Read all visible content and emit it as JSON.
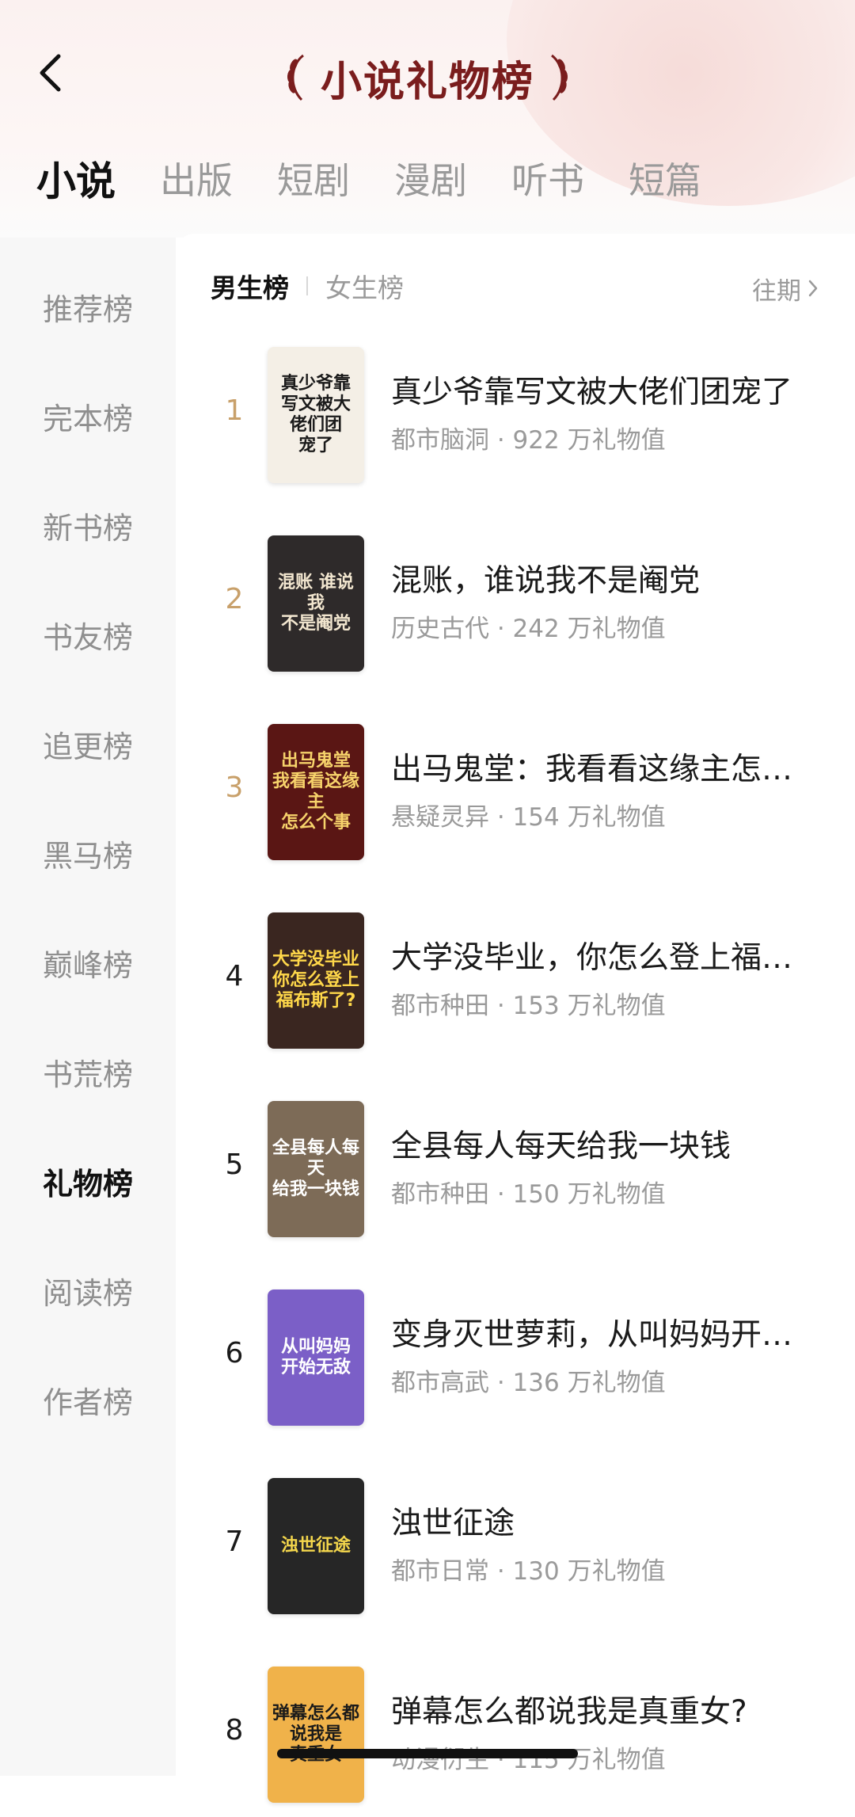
{
  "header": {
    "title": "小说礼物榜",
    "back_icon": "chevron-left-icon"
  },
  "category_tabs": [
    {
      "label": "小说",
      "active": true
    },
    {
      "label": "出版",
      "active": false
    },
    {
      "label": "短剧",
      "active": false
    },
    {
      "label": "漫剧",
      "active": false
    },
    {
      "label": "听书",
      "active": false
    },
    {
      "label": "短篇",
      "active": false
    }
  ],
  "sidebar": {
    "items": [
      {
        "label": "推荐榜",
        "active": false
      },
      {
        "label": "完本榜",
        "active": false
      },
      {
        "label": "新书榜",
        "active": false
      },
      {
        "label": "书友榜",
        "active": false
      },
      {
        "label": "追更榜",
        "active": false
      },
      {
        "label": "黑马榜",
        "active": false
      },
      {
        "label": "巅峰榜",
        "active": false
      },
      {
        "label": "书荒榜",
        "active": false
      },
      {
        "label": "礼物榜",
        "active": true
      },
      {
        "label": "阅读榜",
        "active": false
      },
      {
        "label": "作者榜",
        "active": false
      }
    ]
  },
  "gender_tabs": {
    "male": "男生榜",
    "female": "女生榜",
    "active": "male"
  },
  "past_link": {
    "label": "往期",
    "icon": "chevron-right-icon"
  },
  "books": [
    {
      "rank": "1",
      "title": "真少爷靠写文被大佬们团宠了",
      "meta": "都市脑洞 · 922 万礼物值",
      "cover_text": "真少爷靠\n写文被大\n佬们团\n宠了",
      "cover_bg": "#f4efe6",
      "cover_fg": "#1a1a1a"
    },
    {
      "rank": "2",
      "title": "混账，谁说我不是阉党",
      "meta": "历史古代 · 242 万礼物值",
      "cover_text": "混账 谁说我\n不是阉党",
      "cover_bg": "#2e2a2a",
      "cover_fg": "#f2e6cf"
    },
    {
      "rank": "3",
      "title": "出马鬼堂：我看看这缘主怎…",
      "meta": "悬疑灵异 · 154 万礼物值",
      "cover_text": "出马鬼堂\n我看看这缘主\n怎么个事",
      "cover_bg": "#5a1614",
      "cover_fg": "#f7d36b"
    },
    {
      "rank": "4",
      "title": "大学没毕业，你怎么登上福…",
      "meta": "都市种田 · 153 万礼物值",
      "cover_text": "大学没毕业\n你怎么登上\n福布斯了?",
      "cover_bg": "#3a2620",
      "cover_fg": "#ffd84a"
    },
    {
      "rank": "5",
      "title": "全县每人每天给我一块钱",
      "meta": "都市种田 · 150 万礼物值",
      "cover_text": "全县每人每天\n给我一块钱",
      "cover_bg": "#7d6b57",
      "cover_fg": "#ffffff"
    },
    {
      "rank": "6",
      "title": "变身灭世萝莉，从叫妈妈开…",
      "meta": "都市高武 · 136 万礼物值",
      "cover_text": "从叫妈妈\n开始无敌",
      "cover_bg": "#7b5fc7",
      "cover_fg": "#ffffff"
    },
    {
      "rank": "7",
      "title": "浊世征途",
      "meta": "都市日常 · 130 万礼物值",
      "cover_text": "浊世征途",
      "cover_bg": "#262626",
      "cover_fg": "#f3d64c"
    },
    {
      "rank": "8",
      "title": "弹幕怎么都说我是真重女?",
      "meta": "动漫衍生 · 115 万礼物值",
      "cover_text": "弹幕怎么都说我是\n真重女",
      "cover_bg": "#f0b24a",
      "cover_fg": "#1a1a1a"
    }
  ],
  "colors": {
    "title": "#7a1d1d",
    "top_rank": "#c8a06a",
    "muted": "#9a9a9a",
    "sidebar_bg": "#f7f7f7"
  }
}
